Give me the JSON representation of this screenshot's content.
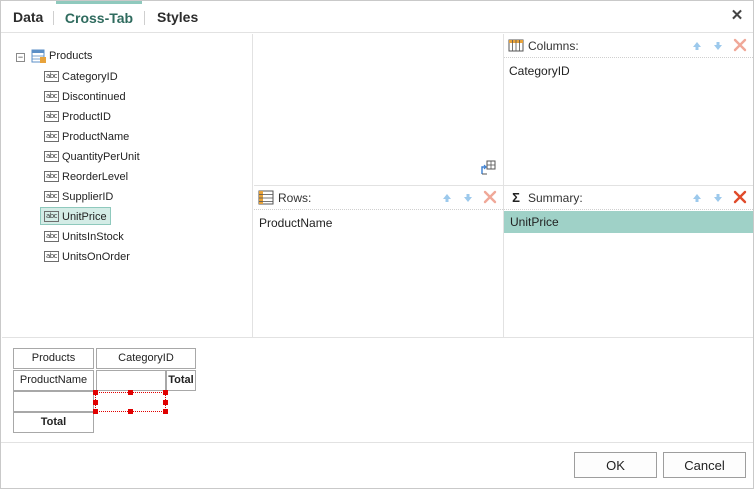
{
  "tabs": [
    {
      "label": "Data"
    },
    {
      "label": "Cross-Tab"
    },
    {
      "label": "Styles"
    }
  ],
  "tree": {
    "root_label": "Products",
    "items": [
      {
        "label": "CategoryID"
      },
      {
        "label": "Discontinued"
      },
      {
        "label": "ProductID"
      },
      {
        "label": "ProductName"
      },
      {
        "label": "QuantityPerUnit"
      },
      {
        "label": "ReorderLevel"
      },
      {
        "label": "SupplierID"
      },
      {
        "label": "UnitPrice"
      },
      {
        "label": "UnitsInStock"
      },
      {
        "label": "UnitsOnOrder"
      }
    ],
    "selected": "UnitPrice",
    "icon_text": "abc"
  },
  "columns_panel": {
    "title": "Columns:",
    "value": "CategoryID"
  },
  "rows_panel": {
    "title": "Rows:",
    "value": "ProductName"
  },
  "summary_panel": {
    "title": "Summary:",
    "value": "UnitPrice",
    "symbol": "Σ"
  },
  "preview": {
    "header_left": "Products",
    "header_right": "CategoryID",
    "row_label": "ProductName",
    "total_col": "Total",
    "total_row": "Total"
  },
  "footer": {
    "ok_label": "OK",
    "cancel_label": "Cancel"
  },
  "colors": {
    "accent": "#8fc9bd",
    "selected_bg": "#9fd1c7",
    "remove": "#e04b2b",
    "arrow": "#7fb8e6"
  }
}
